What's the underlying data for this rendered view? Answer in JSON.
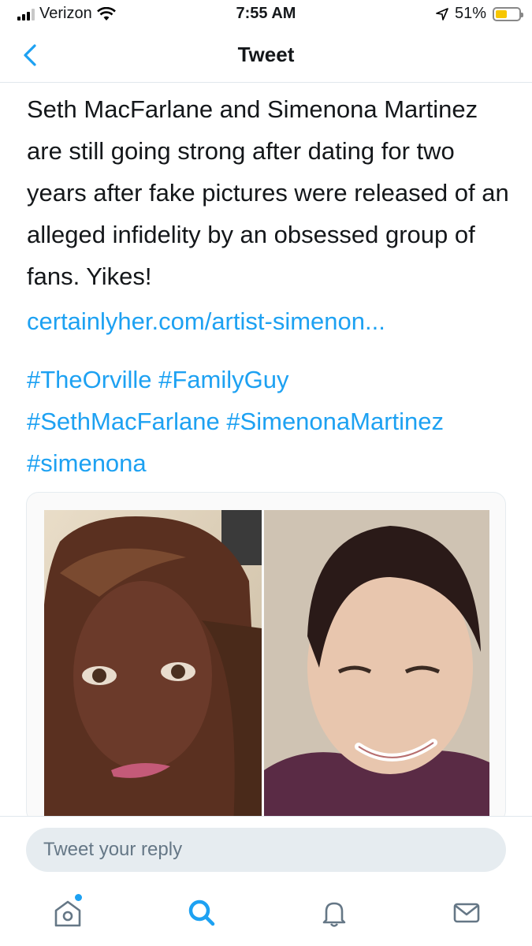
{
  "status_bar": {
    "carrier": "Verizon",
    "time": "7:55 AM",
    "battery_percent": "51%",
    "battery_level": 0.51,
    "icons": [
      "signal-icon",
      "wifi-icon",
      "location-arrow-icon",
      "battery-icon"
    ]
  },
  "nav": {
    "title": "Tweet",
    "back_icon": "chevron-left-icon"
  },
  "tweet": {
    "text": "Seth MacFarlane and Simenona Martinez are still going strong after dating for two years after fake pictures were released of an alleged infidelity by an obsessed group of fans. Yikes!",
    "link": "certainlyher.com/artist-simenon...",
    "hashtags": [
      "#TheOrville",
      "#FamilyGuy",
      "#SethMacFarlane",
      "#SimenonaMartinez",
      "#simenona"
    ]
  },
  "media": {
    "photos": [
      "woman-selfie-photo",
      "man-portrait-photo"
    ]
  },
  "reply": {
    "placeholder": "Tweet your reply"
  },
  "tab_bar": {
    "tabs": [
      "home-icon",
      "search-icon",
      "notifications-bell-icon",
      "messages-envelope-icon"
    ],
    "active_tab": "search-icon",
    "accent": "#1da1f2"
  }
}
